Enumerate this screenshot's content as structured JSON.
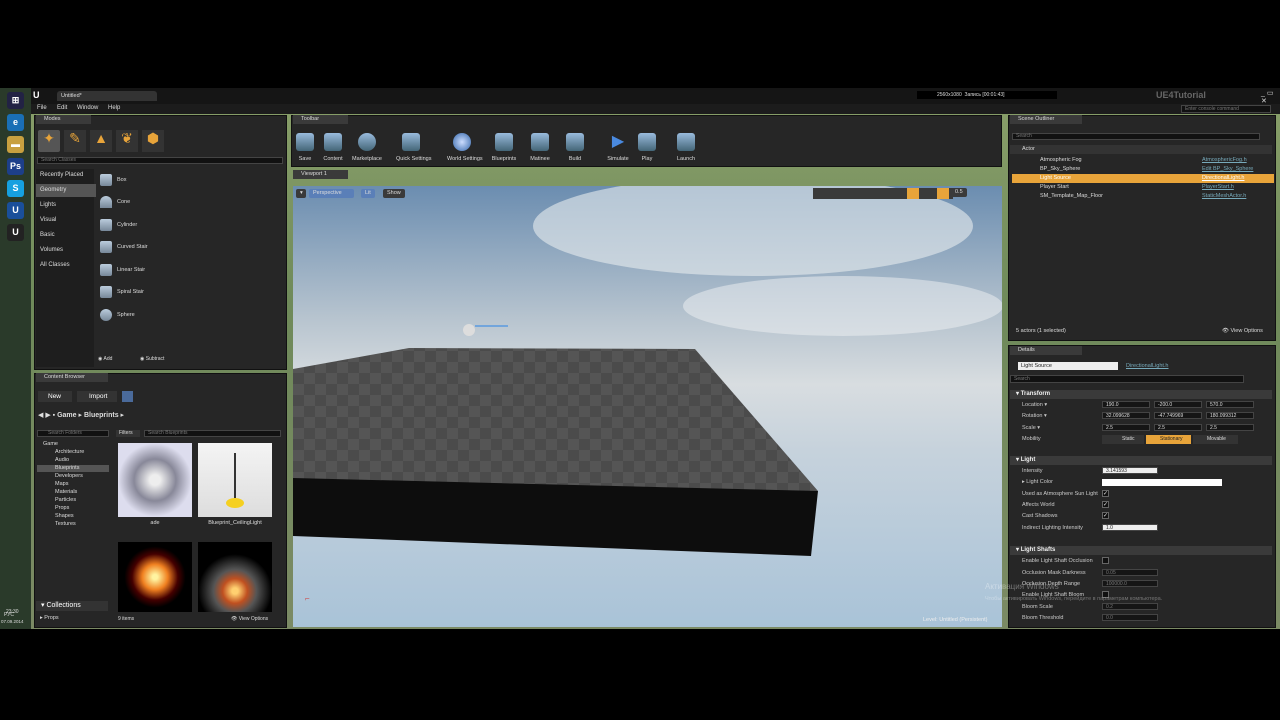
{
  "window": {
    "title": "Untitled*",
    "watermark": "UE4Tutorial",
    "console_placeholder": "Enter console command",
    "recorder_res": "2560x1080",
    "recorder_status": "Запись [00:01:43]"
  },
  "menu": [
    "File",
    "Edit",
    "Window",
    "Help"
  ],
  "taskbar": {
    "lang": "РУС",
    "time": "23:30",
    "date": "07.09.2014"
  },
  "modes": {
    "tab": "Modes",
    "search_placeholder": "Search Classes",
    "categories": [
      "Recently Placed",
      "Geometry",
      "Lights",
      "Visual",
      "Basic",
      "Volumes",
      "All Classes"
    ],
    "selected_category": "Geometry",
    "items": [
      "Box",
      "Cone",
      "Cylinder",
      "Curved Stair",
      "Linear Stair",
      "Spiral Stair",
      "Sphere"
    ],
    "add_label": "Add",
    "subtract_label": "Subtract"
  },
  "toolbar": {
    "tab": "Toolbar",
    "buttons": [
      "Save",
      "Content",
      "Marketplace",
      "Quick Settings",
      "World Settings",
      "Blueprints",
      "Matinee",
      "Build",
      "Simulate",
      "Play",
      "Launch"
    ]
  },
  "viewport": {
    "tab": "Viewport 1",
    "perspective": "Perspective",
    "lit": "Lit",
    "show": "Show",
    "snap_value": "0.5",
    "level_label": "Level:  Untitled (Persistent)"
  },
  "content_browser": {
    "tab": "Content Browser",
    "new_label": "New",
    "import_label": "Import",
    "path": [
      "Game",
      "Blueprints"
    ],
    "folder_search_placeholder": "Search Folders",
    "filters_label": "Filters",
    "asset_search_placeholder": "Search Blueprints",
    "folders": [
      "Game",
      "Architecture",
      "Audio",
      "Blueprints",
      "Developers",
      "Maps",
      "Materials",
      "Particles",
      "Props",
      "Shapes",
      "Textures"
    ],
    "assets": [
      "ade",
      "Blueprint_CeilingLight",
      "",
      ""
    ],
    "count": "9 items",
    "view_options": "View Options",
    "collections": "Collections",
    "props": "Props"
  },
  "outliner": {
    "tab": "Scene Outliner",
    "search_placeholder": "Search",
    "column": "Actor",
    "rows": [
      {
        "name": "Atmospheric Fog",
        "type": "AtmosphericFog.h"
      },
      {
        "name": "BP_Sky_Sphere",
        "type": "Edit BP_Sky_Sphere"
      },
      {
        "name": "Light Source",
        "type": "DirectionalLight.h"
      },
      {
        "name": "Player Start",
        "type": "PlayerStart.h"
      },
      {
        "name": "SM_Template_Map_Floor",
        "type": "StaticMeshActor.h"
      }
    ],
    "status": "5 actors (1 selected)",
    "view_options": "View Options"
  },
  "details": {
    "tab": "Details",
    "name": "Light Source",
    "class": "DirectionalLight.h",
    "search_placeholder": "Search",
    "transform": {
      "title": "Transform",
      "location_label": "Location",
      "location": [
        "190.0",
        "-200.0",
        "570.0"
      ],
      "rotation_label": "Rotation",
      "rotation": [
        "32.099628",
        "-47.749969",
        "180.099312"
      ],
      "scale_label": "Scale",
      "scale": [
        "2.5",
        "2.5",
        "2.5"
      ],
      "mobility_label": "Mobility",
      "mobility": [
        "Static",
        "Stationary",
        "Movable"
      ],
      "mobility_selected": "Stationary"
    },
    "light": {
      "title": "Light",
      "intensity_label": "Intensity",
      "intensity": "3.141593",
      "color_label": "Light Color",
      "sun_label": "Used as Atmosphere Sun Light",
      "affects_label": "Affects World",
      "shadows_label": "Cast Shadows",
      "indirect_label": "Indirect Lighting Intensity",
      "indirect": "1.0"
    },
    "shafts": {
      "title": "Light Shafts",
      "occlusion_label": "Enable Light Shaft Occlusion",
      "mask_label": "Occlusion Mask Darkness",
      "mask": "0.05",
      "depth_label": "Occlusion Depth Range",
      "depth": "100000.0",
      "bloom_label": "Enable Light Shaft Bloom",
      "scale_label": "Bloom Scale",
      "scale": "0.2",
      "threshold_label": "Bloom Threshold",
      "threshold": "0.0"
    }
  },
  "activation": {
    "line1": "Активация Windows",
    "line2": "Чтобы активировать Windows, перейдите в параметрам компьютера."
  },
  "colors": {
    "accent": "#e8a43a",
    "link": "#77aacc",
    "panel": "#262626"
  }
}
